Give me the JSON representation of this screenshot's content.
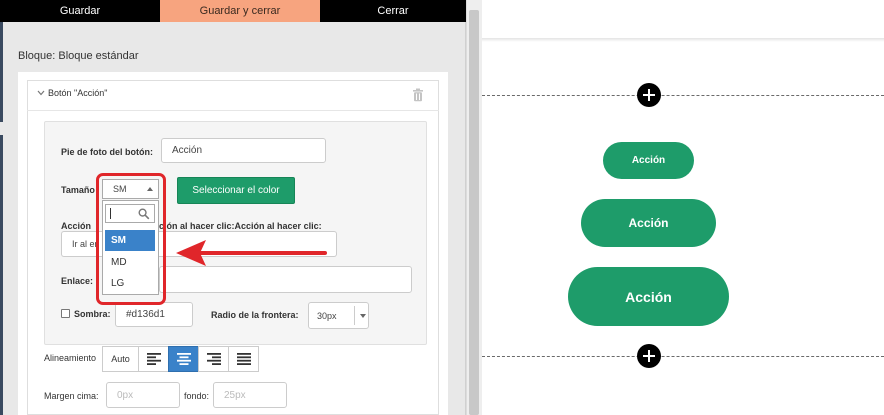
{
  "toolbar": {
    "save_label": "Guardar",
    "save_close_label": "Guardar y cerrar",
    "close_label": "Cerrar"
  },
  "block": {
    "title": "Bloque: Bloque estándar",
    "card_title": "Botón \"Acción\""
  },
  "form": {
    "caption_label": "Pie de foto del botón:",
    "caption_value": "Acción",
    "size_label": "Tamaño",
    "size_selected": "SM",
    "select_color_label": "Seleccionar el color",
    "action_label": "Acción al hacer clic:Acción al hacer clic:Acción al hacer clic:",
    "action_label_visible": "ción al hacer clic:Acción al hacer clic:",
    "action_label_prefix": "Acción",
    "action_value": "Ir al en",
    "link_label": "Enlace:",
    "link_value": "",
    "shadow_label": "Sombra:",
    "shadow_color": "#d136d1",
    "radius_label": "Radio de la frontera:",
    "radius_value": "30px",
    "align_label": "Alineamiento",
    "align_auto": "Auto",
    "margin_top_label": "Margen cima:",
    "margin_top_placeholder": "0px",
    "margin_bottom_label": "fondo:",
    "margin_bottom_placeholder": "25px"
  },
  "dropdown": {
    "search_value": "",
    "options": [
      "SM",
      "MD",
      "LG"
    ],
    "selected": "SM"
  },
  "preview": {
    "button_small": "Acción",
    "button_medium": "Acción",
    "button_large": "Acción"
  },
  "colors": {
    "accent_green": "#1e9c6a",
    "highlight_red": "#e0262a",
    "selected_blue": "#3a82c9",
    "toolbar_orange": "#f7a47f"
  },
  "icons": [
    "chevron-down-icon",
    "trash-icon",
    "search-icon",
    "arrow-left-icon",
    "align-left-icon",
    "align-center-icon",
    "align-right-icon",
    "align-justify-icon",
    "plus-circle-icon",
    "select-caret-icon"
  ]
}
